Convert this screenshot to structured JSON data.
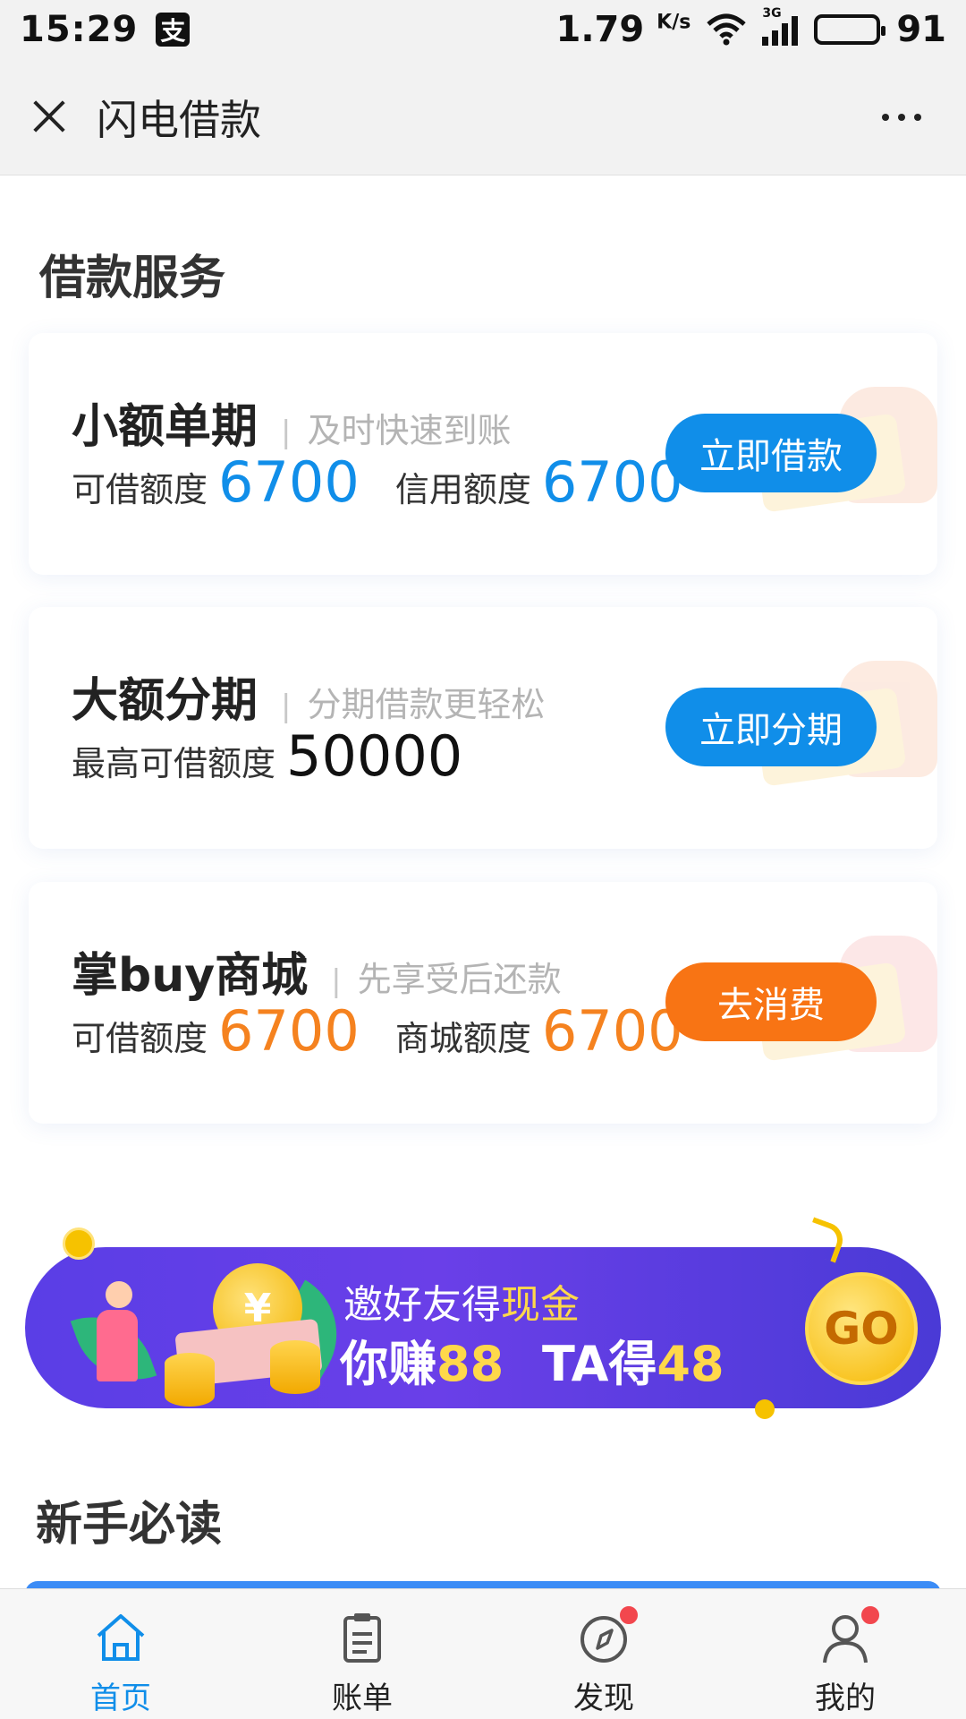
{
  "status_bar": {
    "time": "15:29",
    "app_icon": "alipay-icon",
    "net_speed_value": "1.79",
    "net_speed_unit": "K/s",
    "network_type": "3G",
    "battery_level": "91"
  },
  "header": {
    "title": "闪电借款",
    "close_icon": "close-icon",
    "more_icon": "more-icon"
  },
  "loan_section": {
    "title": "借款服务",
    "cards": [
      {
        "title": "小额单期",
        "subtitle": "及时快速到账",
        "label1": "可借额度",
        "value1": "6700",
        "label2": "信用额度",
        "value2": "6700",
        "button": "立即借款",
        "accent": "#108ee9"
      },
      {
        "title": "大额分期",
        "subtitle": "分期借款更轻松",
        "label1": "最高可借额度",
        "value1": "50000",
        "button": "立即分期",
        "accent": "#108ee9"
      },
      {
        "title": "掌buy商城",
        "subtitle": "先享受后还款",
        "label1": "可借额度",
        "value1": "6700",
        "label2": "商城额度",
        "value2": "6700",
        "button": "去消费",
        "accent": "#f5821f"
      }
    ]
  },
  "banner": {
    "line1_prefix": "邀好友得",
    "line1_highlight": "现金",
    "line2_a": "你赚",
    "line2_a_value": "88",
    "line2_b": "TA得",
    "line2_b_value": "48",
    "go_label": "GO",
    "coin_symbol": "¥"
  },
  "guide_section": {
    "title": "新手必读"
  },
  "tab_bar": {
    "tabs": [
      {
        "label": "首页",
        "icon": "home-icon",
        "active": true,
        "badge": false
      },
      {
        "label": "账单",
        "icon": "bill-icon",
        "active": false,
        "badge": false
      },
      {
        "label": "发现",
        "icon": "compass-icon",
        "active": false,
        "badge": true
      },
      {
        "label": "我的",
        "icon": "user-icon",
        "active": false,
        "badge": true
      }
    ]
  }
}
